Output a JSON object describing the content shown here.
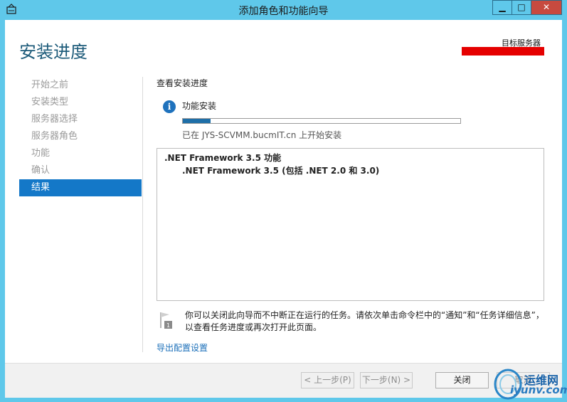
{
  "window": {
    "title": "添加角色和功能向导",
    "controls": {
      "minimize": "▁",
      "maximize": "□",
      "close": "✕"
    }
  },
  "header": {
    "page_title": "安装进度",
    "target_server_label": "目标服务器"
  },
  "sidebar": {
    "items": [
      {
        "label": "开始之前",
        "active": false
      },
      {
        "label": "安装类型",
        "active": false
      },
      {
        "label": "服务器选择",
        "active": false
      },
      {
        "label": "服务器角色",
        "active": false
      },
      {
        "label": "功能",
        "active": false
      },
      {
        "label": "确认",
        "active": false
      },
      {
        "label": "结果",
        "active": true
      }
    ]
  },
  "main": {
    "section_title": "查看安装进度",
    "progress": {
      "title": "功能安装",
      "fraction": 0.1,
      "status": "已在 JYS-SCVMM.bucmIT.cn 上开始安装"
    },
    "results": {
      "feature": ".NET Framework 3.5 功能",
      "subfeature": ".NET Framework 3.5 (包括 .NET 2.0 和 3.0)"
    },
    "note": "你可以关闭此向导而不中断正在运行的任务。请依次单击命令栏中的“通知”和“任务详细信息”，以查看任务进度或再次打开此页面。",
    "export_link": "导出配置设置"
  },
  "footer": {
    "prev": "< 上一步(P)",
    "next": "下一步(N) >",
    "close": "关闭",
    "cancel": "取消"
  },
  "watermark": {
    "line1": "运维网",
    "line2": "iyunv.com"
  },
  "colors": {
    "accent": "#1478c8",
    "title_bar": "#5fc8ea",
    "close_button": "#c74a3f",
    "progress": "#1f6fa8",
    "link": "#1b6fb9"
  },
  "icons": {
    "app": "server-manager-icon",
    "info": "info-icon",
    "flag": "flag-icon",
    "watermark": "ring-logo-icon"
  }
}
